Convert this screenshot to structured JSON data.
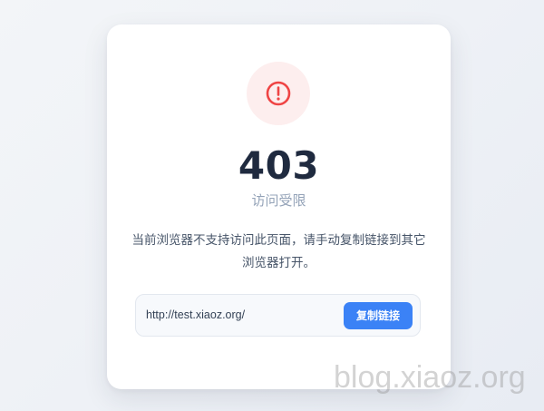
{
  "error": {
    "icon": "alert-circle-icon",
    "code": "403",
    "title": "访问受限",
    "message_line1": "当前浏览器不支持访问此页面，请手动复制链接到其它",
    "message_line2": "浏览器打开。"
  },
  "link": {
    "url": "http://test.xiaoz.org/",
    "copy_label": "复制链接"
  },
  "watermark": "blog.xiaoz.org",
  "colors": {
    "accent": "#3b82f6",
    "danger": "#ef4444",
    "danger_bg": "#fdeeee",
    "heading": "#1f2a3f",
    "muted": "#94a3b8",
    "body_text": "#475569"
  }
}
